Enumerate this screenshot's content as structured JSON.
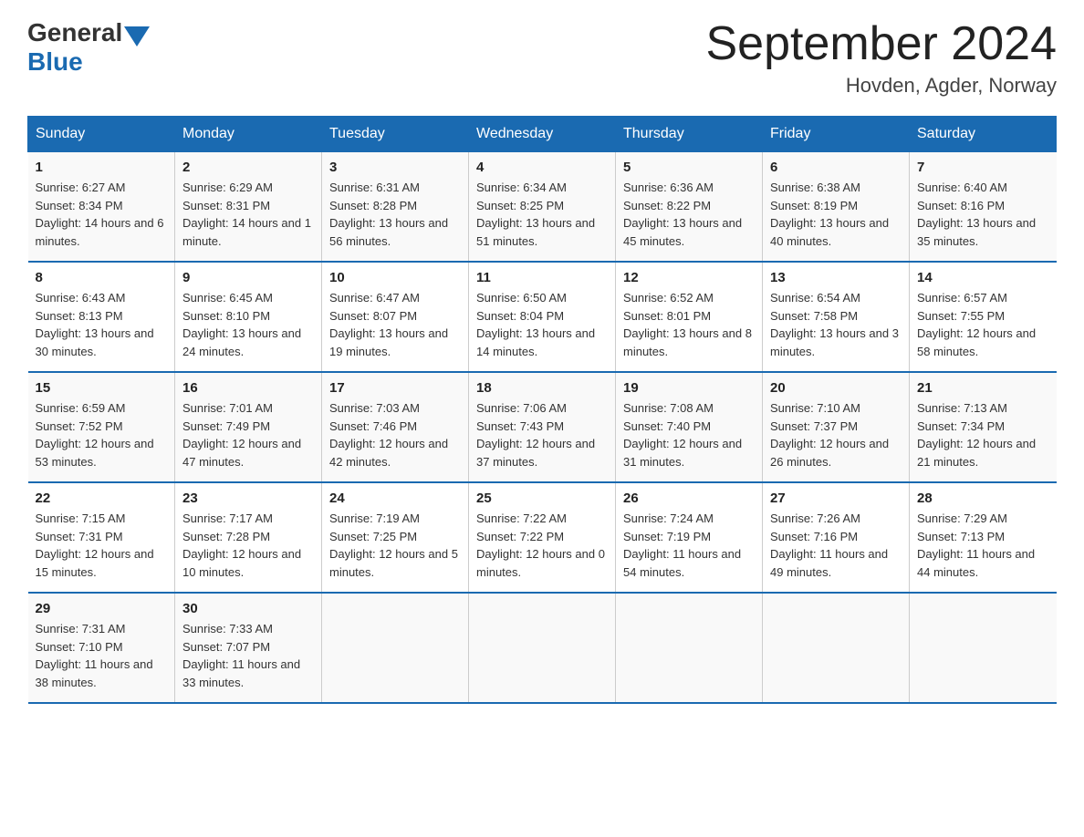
{
  "header": {
    "logo_general": "General",
    "logo_blue": "Blue",
    "month_title": "September 2024",
    "location": "Hovden, Agder, Norway"
  },
  "weekdays": [
    "Sunday",
    "Monday",
    "Tuesday",
    "Wednesday",
    "Thursday",
    "Friday",
    "Saturday"
  ],
  "weeks": [
    [
      {
        "day": "1",
        "sunrise": "6:27 AM",
        "sunset": "8:34 PM",
        "daylight": "14 hours and 6 minutes."
      },
      {
        "day": "2",
        "sunrise": "6:29 AM",
        "sunset": "8:31 PM",
        "daylight": "14 hours and 1 minute."
      },
      {
        "day": "3",
        "sunrise": "6:31 AM",
        "sunset": "8:28 PM",
        "daylight": "13 hours and 56 minutes."
      },
      {
        "day": "4",
        "sunrise": "6:34 AM",
        "sunset": "8:25 PM",
        "daylight": "13 hours and 51 minutes."
      },
      {
        "day": "5",
        "sunrise": "6:36 AM",
        "sunset": "8:22 PM",
        "daylight": "13 hours and 45 minutes."
      },
      {
        "day": "6",
        "sunrise": "6:38 AM",
        "sunset": "8:19 PM",
        "daylight": "13 hours and 40 minutes."
      },
      {
        "day": "7",
        "sunrise": "6:40 AM",
        "sunset": "8:16 PM",
        "daylight": "13 hours and 35 minutes."
      }
    ],
    [
      {
        "day": "8",
        "sunrise": "6:43 AM",
        "sunset": "8:13 PM",
        "daylight": "13 hours and 30 minutes."
      },
      {
        "day": "9",
        "sunrise": "6:45 AM",
        "sunset": "8:10 PM",
        "daylight": "13 hours and 24 minutes."
      },
      {
        "day": "10",
        "sunrise": "6:47 AM",
        "sunset": "8:07 PM",
        "daylight": "13 hours and 19 minutes."
      },
      {
        "day": "11",
        "sunrise": "6:50 AM",
        "sunset": "8:04 PM",
        "daylight": "13 hours and 14 minutes."
      },
      {
        "day": "12",
        "sunrise": "6:52 AM",
        "sunset": "8:01 PM",
        "daylight": "13 hours and 8 minutes."
      },
      {
        "day": "13",
        "sunrise": "6:54 AM",
        "sunset": "7:58 PM",
        "daylight": "13 hours and 3 minutes."
      },
      {
        "day": "14",
        "sunrise": "6:57 AM",
        "sunset": "7:55 PM",
        "daylight": "12 hours and 58 minutes."
      }
    ],
    [
      {
        "day": "15",
        "sunrise": "6:59 AM",
        "sunset": "7:52 PM",
        "daylight": "12 hours and 53 minutes."
      },
      {
        "day": "16",
        "sunrise": "7:01 AM",
        "sunset": "7:49 PM",
        "daylight": "12 hours and 47 minutes."
      },
      {
        "day": "17",
        "sunrise": "7:03 AM",
        "sunset": "7:46 PM",
        "daylight": "12 hours and 42 minutes."
      },
      {
        "day": "18",
        "sunrise": "7:06 AM",
        "sunset": "7:43 PM",
        "daylight": "12 hours and 37 minutes."
      },
      {
        "day": "19",
        "sunrise": "7:08 AM",
        "sunset": "7:40 PM",
        "daylight": "12 hours and 31 minutes."
      },
      {
        "day": "20",
        "sunrise": "7:10 AM",
        "sunset": "7:37 PM",
        "daylight": "12 hours and 26 minutes."
      },
      {
        "day": "21",
        "sunrise": "7:13 AM",
        "sunset": "7:34 PM",
        "daylight": "12 hours and 21 minutes."
      }
    ],
    [
      {
        "day": "22",
        "sunrise": "7:15 AM",
        "sunset": "7:31 PM",
        "daylight": "12 hours and 15 minutes."
      },
      {
        "day": "23",
        "sunrise": "7:17 AM",
        "sunset": "7:28 PM",
        "daylight": "12 hours and 10 minutes."
      },
      {
        "day": "24",
        "sunrise": "7:19 AM",
        "sunset": "7:25 PM",
        "daylight": "12 hours and 5 minutes."
      },
      {
        "day": "25",
        "sunrise": "7:22 AM",
        "sunset": "7:22 PM",
        "daylight": "12 hours and 0 minutes."
      },
      {
        "day": "26",
        "sunrise": "7:24 AM",
        "sunset": "7:19 PM",
        "daylight": "11 hours and 54 minutes."
      },
      {
        "day": "27",
        "sunrise": "7:26 AM",
        "sunset": "7:16 PM",
        "daylight": "11 hours and 49 minutes."
      },
      {
        "day": "28",
        "sunrise": "7:29 AM",
        "sunset": "7:13 PM",
        "daylight": "11 hours and 44 minutes."
      }
    ],
    [
      {
        "day": "29",
        "sunrise": "7:31 AM",
        "sunset": "7:10 PM",
        "daylight": "11 hours and 38 minutes."
      },
      {
        "day": "30",
        "sunrise": "7:33 AM",
        "sunset": "7:07 PM",
        "daylight": "11 hours and 33 minutes."
      },
      null,
      null,
      null,
      null,
      null
    ]
  ],
  "labels": {
    "sunrise": "Sunrise:",
    "sunset": "Sunset:",
    "daylight": "Daylight:"
  }
}
